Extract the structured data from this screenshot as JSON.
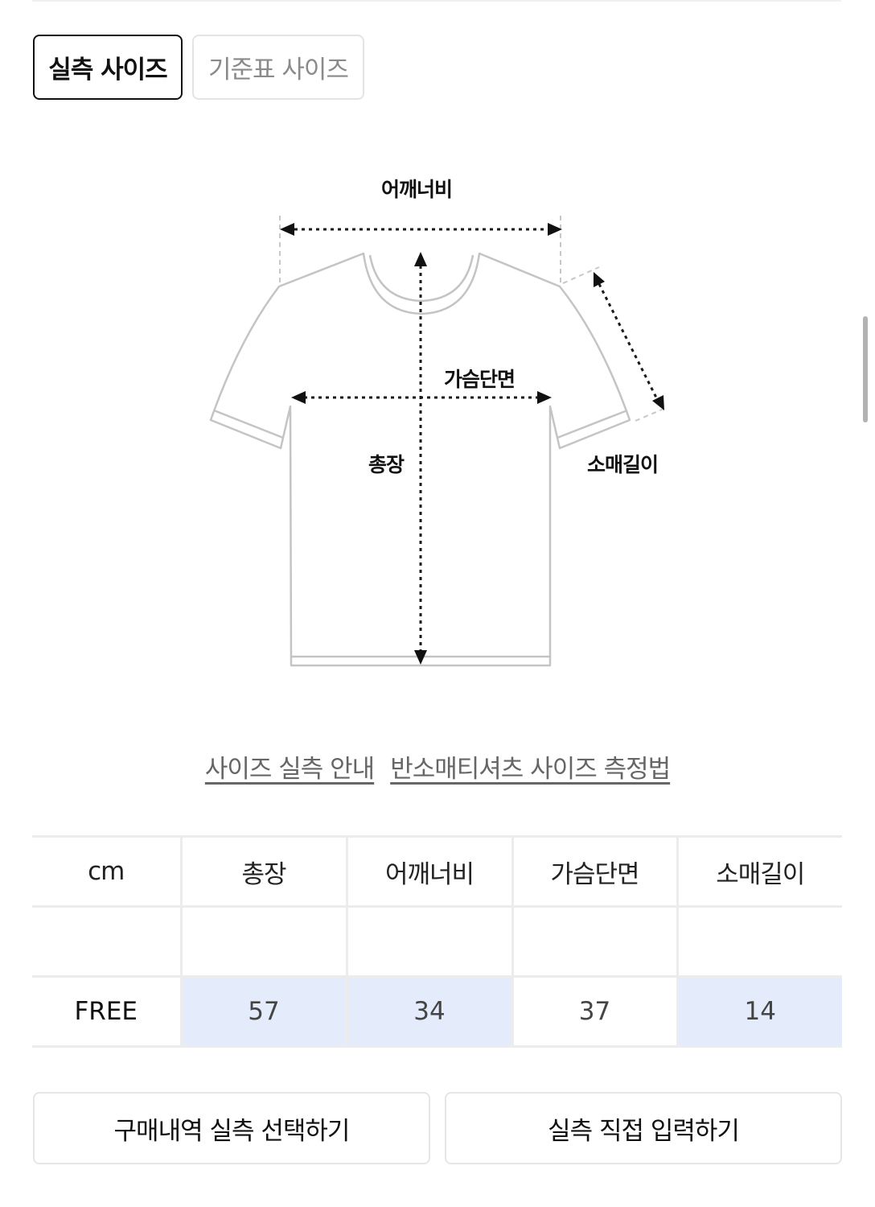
{
  "tabs": {
    "active": "실측 사이즈",
    "inactive": "기준표 사이즈"
  },
  "diagram": {
    "labels": {
      "shoulder": "어깨너비",
      "chest": "가슴단면",
      "length": "총장",
      "sleeve": "소매길이"
    }
  },
  "links": {
    "guide": "사이즈 실측 안내",
    "method": "반소매티셔츠 사이즈 측정법"
  },
  "table": {
    "unit": "cm",
    "headers": [
      "총장",
      "어깨너비",
      "가슴단면",
      "소매길이"
    ],
    "rows": [
      {
        "label": "FREE",
        "values": [
          "57",
          "34",
          "37",
          "14"
        ],
        "highlighted": [
          true,
          true,
          false,
          true
        ]
      }
    ],
    "highlight_color": "#e4ecfc"
  },
  "actions": {
    "purchase_select": "구매내역 실측 선택하기",
    "manual_input": "실측 직접 입력하기"
  }
}
